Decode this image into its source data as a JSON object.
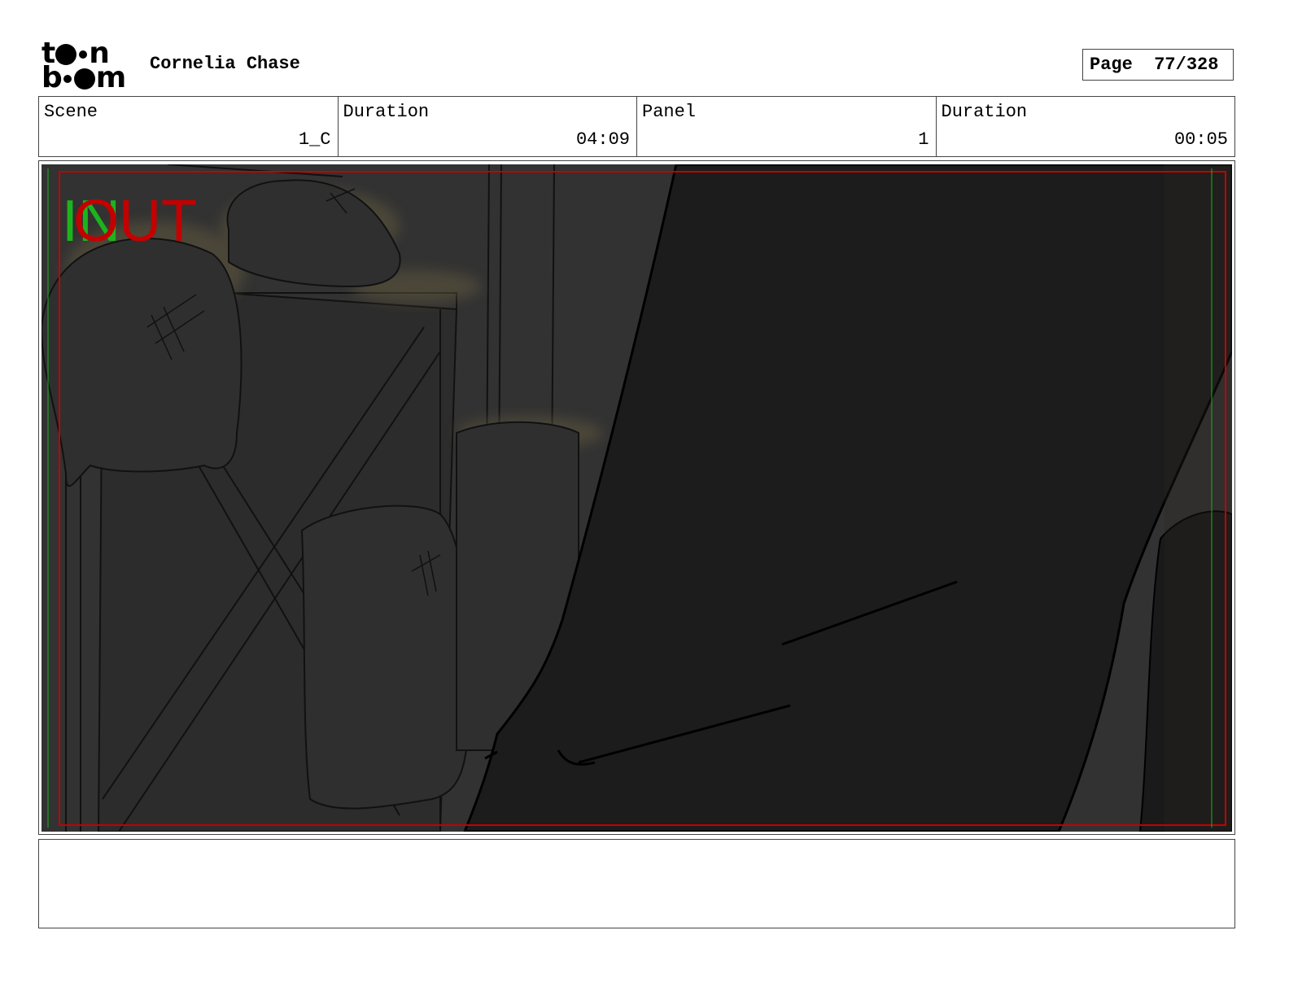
{
  "logo": {
    "line1": "t",
    "line1_end": "n",
    "line2": "b",
    "line2_end": "m"
  },
  "header": {
    "project_title": "Cornelia Chase",
    "page_label": "Page",
    "page_number": "77/328"
  },
  "info": [
    {
      "label": "Scene",
      "value": "1_C"
    },
    {
      "label": "Duration",
      "value": "04:09"
    },
    {
      "label": "Panel",
      "value": "1"
    },
    {
      "label": "Duration",
      "value": "00:05"
    }
  ],
  "panel": {
    "in_marker": "IN",
    "out_marker": "OUT",
    "colors": {
      "in": "#1db31d",
      "out": "#c40000",
      "frame": "#c40000",
      "safe": "#1db31d"
    }
  },
  "notes": {
    "text": ""
  }
}
